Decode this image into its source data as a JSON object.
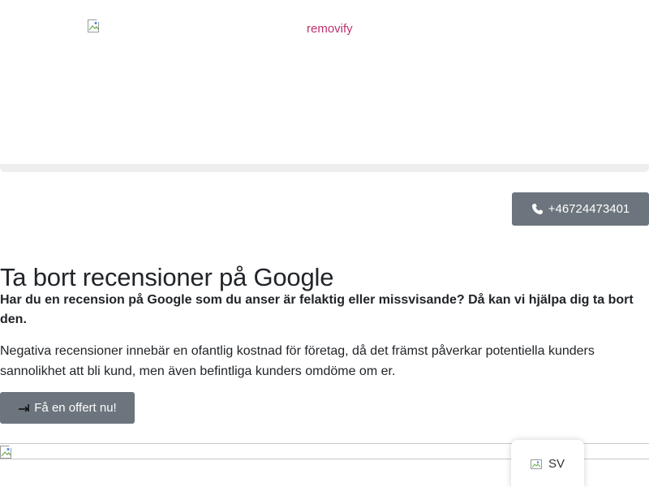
{
  "header": {
    "logo_alt": "removify",
    "logo_color": "#c0326f"
  },
  "contact": {
    "phone_label": "+46724473401",
    "icon": "phone-icon"
  },
  "main": {
    "title": "Ta bort recensioner på Google",
    "lead": "Har du en recension på Google som du anser är felaktig eller missvisande? Då kan vi hjälpa dig ta bort den.",
    "body": "Negativa recensioner innebär en ofantlig kostnad för företag, då det främst påverkar potentiella kunders sannolikhet att bli kund, men även befintliga kunders omdöme om er.",
    "cta_label": "Få en offert nu!",
    "cta_icon": "arrow-right-icon"
  },
  "language": {
    "current": "SV",
    "icon": "flag-icon"
  },
  "colors": {
    "button_bg": "#6c757d",
    "text": "#212529",
    "accent": "#c0326f"
  }
}
